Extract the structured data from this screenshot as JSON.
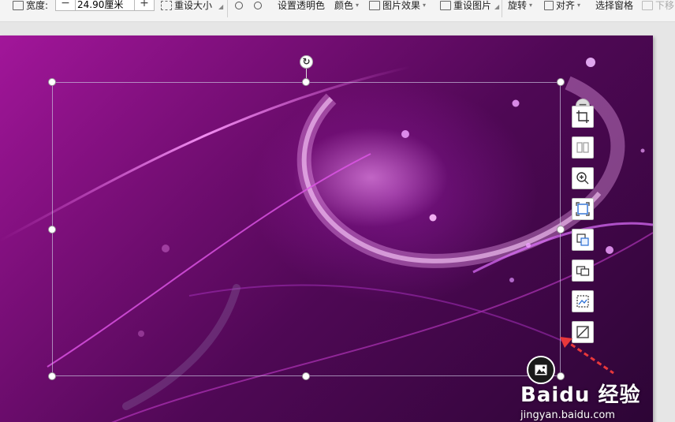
{
  "toolbar": {
    "width_label": "宽度:",
    "width_value": "24.90厘米",
    "decrease_label": "−",
    "increase_label": "+",
    "reset_size_label": "重设大小",
    "transparent_color_label": "设置透明色",
    "color_label": "颜色",
    "picture_effects_label": "图片效果",
    "reset_picture_label": "重设图片",
    "rotate_label": "旋转",
    "align_label": "对齐",
    "selection_pane_label": "选择窗格",
    "move_down_label": "下移"
  },
  "canvas": {
    "rotate_glyph": "↻",
    "collapse_glyph": "−",
    "float_tools": [
      {
        "name": "crop-icon"
      },
      {
        "name": "split-icon"
      },
      {
        "name": "zoom-icon"
      },
      {
        "name": "frame-icon"
      },
      {
        "name": "replace-picture-icon"
      },
      {
        "name": "insert-picture-icon"
      },
      {
        "name": "picture-settings-icon"
      },
      {
        "name": "edit-picture-icon"
      }
    ]
  },
  "watermark": {
    "brand": "Baidu 经验",
    "url": "jingyan.baidu.com"
  },
  "colors": {
    "slide_primary": "#7c0f7a",
    "slide_dark": "#2c0535",
    "accent_glow": "#f0a0ff"
  }
}
